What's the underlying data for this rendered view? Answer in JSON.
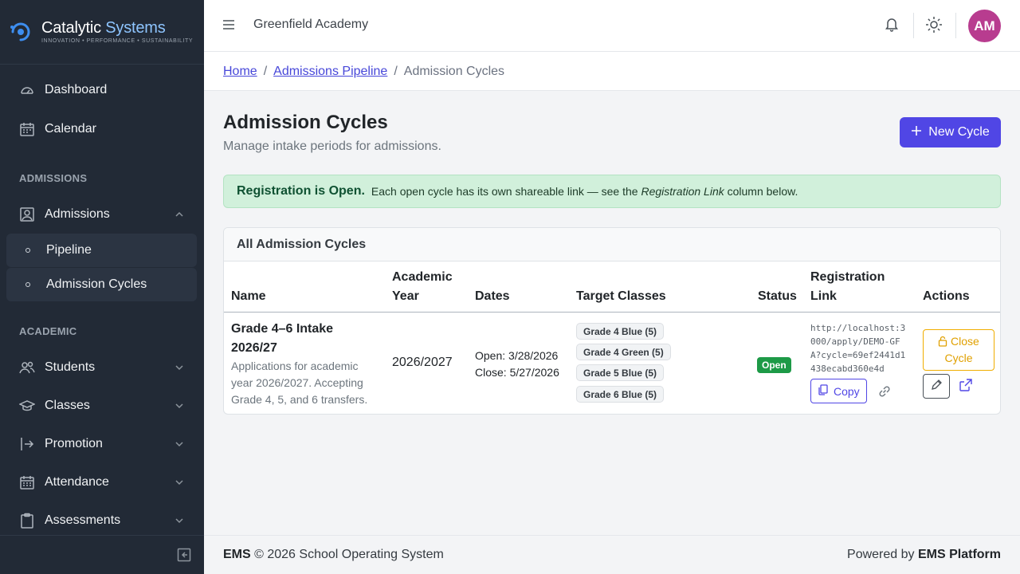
{
  "brand": {
    "name_part1": "Catalytic",
    "name_part2": "Systems",
    "tagline": "INNOVATION • PERFORMANCE • SUSTAINABILITY"
  },
  "sidebar": {
    "items": [
      {
        "label": "Dashboard",
        "icon": "speedometer-icon"
      },
      {
        "label": "Calendar",
        "icon": "calendar-icon"
      }
    ],
    "sections": [
      {
        "title": "ADMISSIONS"
      },
      {
        "title": "ACADEMIC"
      }
    ],
    "admissions": {
      "label": "Admissions",
      "sub": [
        {
          "label": "Pipeline"
        },
        {
          "label": "Admission Cycles"
        }
      ]
    },
    "academic": [
      {
        "label": "Students"
      },
      {
        "label": "Classes"
      },
      {
        "label": "Promotion"
      },
      {
        "label": "Attendance"
      },
      {
        "label": "Assessments"
      }
    ]
  },
  "topbar": {
    "org_name": "Greenfield Academy",
    "avatar_initials": "AM"
  },
  "breadcrumb": {
    "home": "Home",
    "pipeline": "Admissions Pipeline",
    "current": "Admission Cycles"
  },
  "page": {
    "title": "Admission Cycles",
    "subtitle": "Manage intake periods for admissions.",
    "new_button": "New Cycle"
  },
  "alert": {
    "strong": "Registration is Open.",
    "text_before": "Each open cycle has its own shareable link — see the",
    "emphasis": "Registration Link",
    "text_after": "column below."
  },
  "table": {
    "card_title": "All Admission Cycles",
    "headers": {
      "name": "Name",
      "year_line1": "Academic",
      "year_line2": "Year",
      "dates": "Dates",
      "targets": "Target Classes",
      "status": "Status",
      "link_line1": "Registration",
      "link_line2": "Link",
      "actions": "Actions"
    },
    "rows": [
      {
        "name_line1": "Grade 4–6 Intake",
        "name_line2": "2026/27",
        "desc_line1": "Applications for academic",
        "desc_line2": "year 2026/2027. Accepting",
        "desc_line3": "Grade 4, 5, and 6 transfers.",
        "academic_year": "2026/2027",
        "open_date": "Open: 3/28/2026",
        "close_date": "Close: 5/27/2026",
        "targets": [
          "Grade 4 Blue (5)",
          "Grade 4 Green (5)",
          "Grade 5 Blue (5)",
          "Grade 6 Blue (5)"
        ],
        "status": "Open",
        "link": "http://localhost:3000/apply/DEMO-GFA?cycle=69ef2441d1438ecabd360e4d",
        "copy_label": "Copy",
        "close_label_line1": "Close",
        "close_label_line2": "Cycle"
      }
    ]
  },
  "footer": {
    "left_bold": "EMS",
    "left_rest": "© 2026 School Operating System",
    "right_prefix": "Powered by",
    "right_bold": "EMS Platform"
  },
  "colors": {
    "primary": "#5046e5",
    "sidebar": "#222a36",
    "success": "#1d9a47",
    "warning": "#f0ad00",
    "avatar": "#b83c8f"
  }
}
